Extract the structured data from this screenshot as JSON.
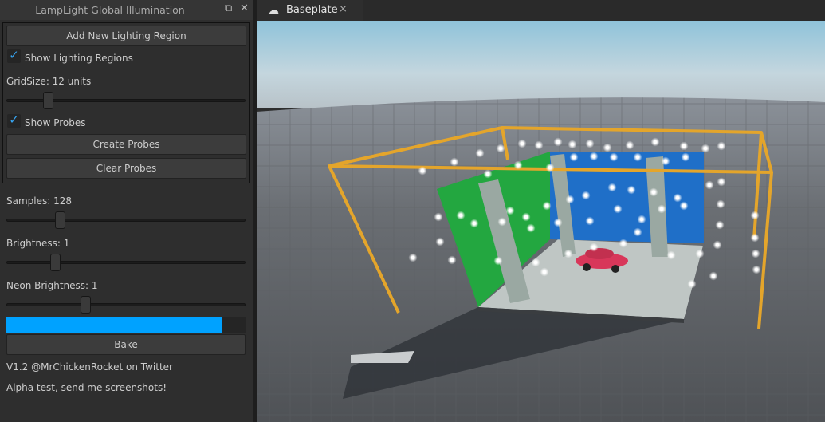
{
  "panel": {
    "title": "LampLight Global Illumination",
    "dock_icon": "undock-icon",
    "close_icon": "close-icon",
    "add_region_label": "Add New Lighting Region",
    "show_regions_label": "Show Lighting Regions",
    "show_regions_checked": true,
    "gridsize_label": "GridSize: 12 units",
    "gridsize_slider": 0.17,
    "show_probes_label": "Show Probes",
    "show_probes_checked": true,
    "create_probes_label": "Create Probes",
    "clear_probes_label": "Clear Probes",
    "samples_label": "Samples: 128",
    "samples_slider": 0.22,
    "brightness_label": "Brightness: 1",
    "brightness_slider": 0.2,
    "neon_label": "Neon Brightness: 1",
    "neon_slider": 0.33,
    "progress": 0.9,
    "bake_label": "Bake",
    "version_text": "V1.2 @MrChickenRocket on Twitter",
    "alpha_text": "Alpha test, send me screenshots!",
    "accent": "#00a2ff"
  },
  "tabs": [
    {
      "label": "Baseplate",
      "icon": "cloud-icon",
      "close": "×"
    }
  ],
  "checkmark": "✓"
}
